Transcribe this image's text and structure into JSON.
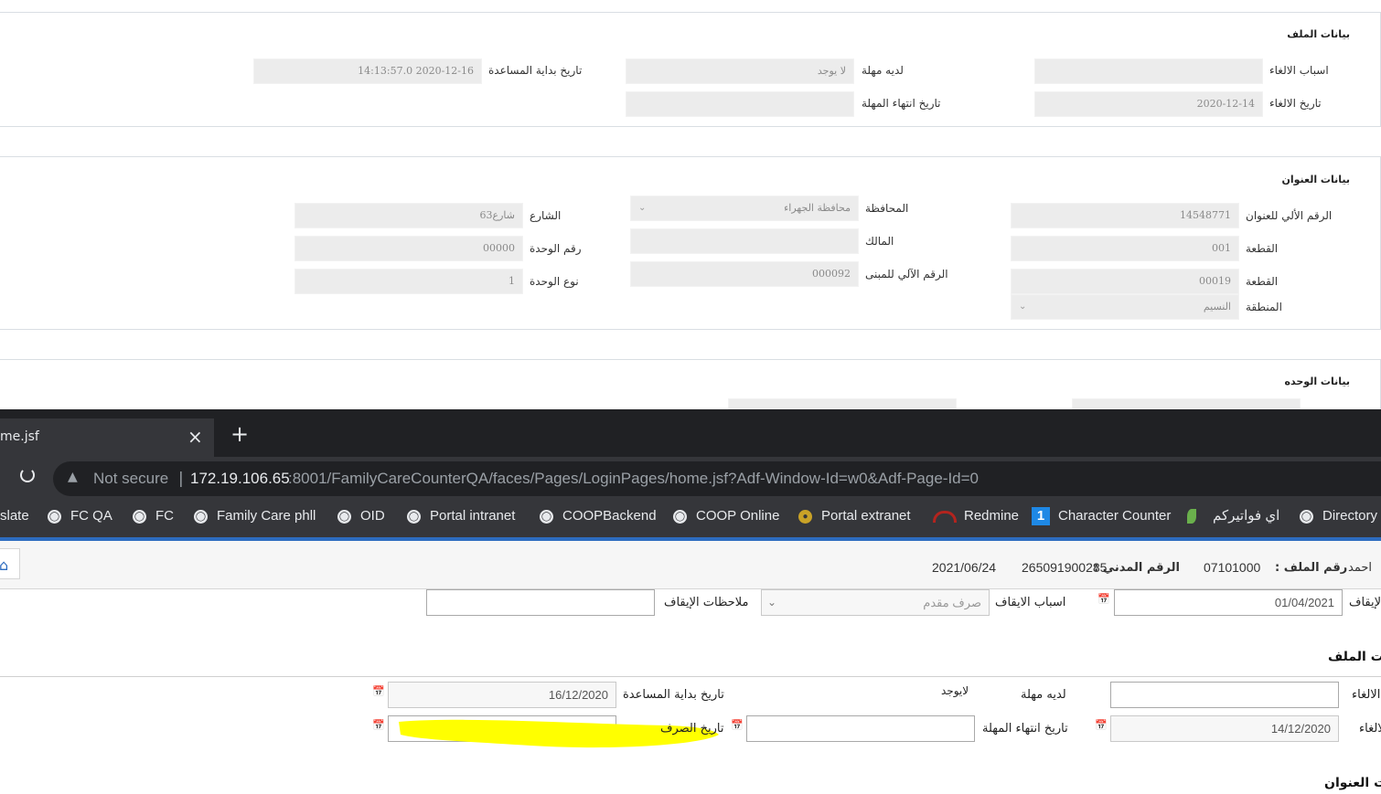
{
  "bg_form": {
    "file_section": {
      "title": "بيانات الملف",
      "cancel_reasons_label": "اسباب الالغاء",
      "cancel_reasons_value": "",
      "cancel_date_label": "تاريخ الالغاء",
      "cancel_date_value": "2020-12-14",
      "grace_label": "لديه مهلة",
      "grace_value": "لا يوجد",
      "grace_end_label": "تاريخ انتهاء المهلة",
      "grace_end_value": "",
      "aid_start_label": "تاريخ بداية المساعدة",
      "aid_start_value": "2020-12-16 14:13:57.0"
    },
    "address_section": {
      "title": "بيانات العنوان",
      "auto_addr_label": "الرقم الألي للعنوان",
      "auto_addr_value": "14548771",
      "block_label": "القطعة",
      "block_value": "001",
      "block2_label": "القطعة",
      "block2_value": "00019",
      "area_label": "المنطقة",
      "area_value": "النسيم",
      "governorate_label": "المحافظة",
      "governorate_value": "محافظة الجهراء",
      "owner_label": "المالك",
      "owner_value": "",
      "building_no_label": "الرقم الآلي للمبنى",
      "building_no_value": "000092",
      "street_label": "الشارع",
      "street_value": "شارع63",
      "unit_no_label": "رقم الوحدة",
      "unit_no_value": "00000",
      "unit_type_label": "نوع الوحدة",
      "unit_type_value": "1"
    },
    "unit_section": {
      "title": "بيانات الوحده"
    }
  },
  "browser": {
    "tab_title": "me.jsf",
    "tab_close": "×",
    "new_tab": "+",
    "reload": "C",
    "not_secure": "Not secure",
    "url_host": "172.19.106.65",
    "url_rest": ":8001/FamilyCareCounterQA/faces/Pages/LoginPages/home.jsf?Adf-Window-Id=w0&Adf-Page-Id=0",
    "bookmarks": [
      "slate",
      "FC QA",
      "FC",
      "Family Care phll",
      "OID",
      "Portal intranet",
      "COOPBackend",
      "COOP Online",
      "Portal extranet",
      "Redmine",
      "Character Counter",
      "اي فواتيركم",
      "Directory"
    ]
  },
  "info_bar": {
    "name": "احمد",
    "file_no_label": "رقم الملف :",
    "file_no_value": "07101000",
    "civil_id_label": "الرقم المدني :",
    "civil_id_value": "265091900285",
    "date": "2021/06/24"
  },
  "fg_form": {
    "suspend_date_label": "الإيقاف",
    "suspend_date_value": "01/04/2021",
    "suspend_reasons_label": "اسباب الايقاف",
    "suspend_reasons_value": "صرف مقدم",
    "suspend_notes_label": "ملاحظات الإيقاف",
    "suspend_notes_value": "",
    "file_section_title": "ت الملف",
    "cancel_label": "الالغاء",
    "cancel_value": "",
    "cancel_date_label": "لالغاء",
    "cancel_date_value": "14/12/2020",
    "grace_label": "لديه مهلة",
    "grace_value": "لايوجد",
    "grace_end_label": "تاريخ انتهاء المهلة",
    "grace_end_value": "",
    "aid_start_label": "تاريخ بداية المساعدة",
    "aid_start_value": "16/12/2020",
    "disbursement_date_label": "تاريخ الصرف",
    "disbursement_date_value": "",
    "address_section_title": "ت العنوان"
  },
  "colors": {
    "highlight": "#ffff00",
    "chrome_dark": "#35363a",
    "accent_blue": "#2d6cc0"
  }
}
